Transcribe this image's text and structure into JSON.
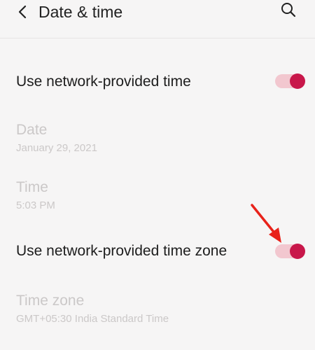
{
  "header": {
    "title": "Date & time",
    "back_icon": "chevron-left-icon",
    "search_icon": "search-icon"
  },
  "settings": {
    "network_time": {
      "label": "Use network-provided time",
      "enabled": true
    },
    "date": {
      "label": "Date",
      "value": "January 29, 2021"
    },
    "time": {
      "label": "Time",
      "value": "5:03 PM"
    },
    "network_zone": {
      "label": "Use network-provided time zone",
      "enabled": true
    },
    "time_zone": {
      "label": "Time zone",
      "value": "GMT+05:30 India Standard Time"
    }
  },
  "colors": {
    "accent": "#c8174a",
    "toggle_track": "#f2c7cf",
    "annotation_arrow": "#e8221a",
    "disabled_text": "#cbc8c8",
    "background": "#f6f5f5"
  }
}
